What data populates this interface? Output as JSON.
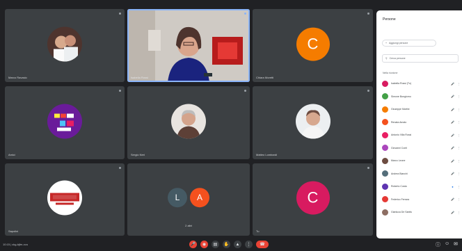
{
  "panel": {
    "title": "Persone",
    "add_label": "Aggiungi persone",
    "search_placeholder": "Cerca persone",
    "section_label": "Nella riunione",
    "participants": [
      {
        "name": "Isabella Rossi (Tu)",
        "color": "#d81b60"
      },
      {
        "name": "Simone Bongiorno",
        "color": "#43a047"
      },
      {
        "name": "Giuseppe Martini",
        "color": "#f57c00"
      },
      {
        "name": "Renata Amato",
        "color": "#f4511e"
      },
      {
        "name": "Antonio Villa Rossi",
        "color": "#e91e63"
      },
      {
        "name": "Giovanni Conti",
        "color": "#ab47bc"
      },
      {
        "name": "Marco Leone",
        "color": "#6d4c41"
      },
      {
        "name": "Andrea Bianchi",
        "color": "#546e7a"
      },
      {
        "name": "Roberto Costa",
        "color": "#5e35b1"
      },
      {
        "name": "Federico Ferrara",
        "color": "#e53935"
      },
      {
        "name": "Gianluca De Santis",
        "color": "#8d6e63"
      }
    ]
  },
  "tiles": [
    {
      "name": "Marco Ravasio",
      "type": "photo",
      "bg": "#3a2a2a"
    },
    {
      "name": "Isabella Rossi",
      "type": "video",
      "active": true
    },
    {
      "name": "Chiara Moretti",
      "type": "letter",
      "letter": "C",
      "color": "#f57c00"
    },
    {
      "name": "Amici",
      "type": "photo",
      "bg": "#6a1b9a"
    },
    {
      "name": "Sergio Neri",
      "type": "photo",
      "bg": "#d7ccc8"
    },
    {
      "name": "Matteo Lombardi",
      "type": "photo",
      "bg": "#eceff1"
    },
    {
      "name": "Sapolini",
      "type": "photo",
      "bg": "#ffffff"
    },
    {
      "name": "2 altri",
      "type": "group",
      "letters": [
        "L",
        "A"
      ],
      "colors": [
        "#455a64",
        "#f4511e"
      ]
    },
    {
      "name": "Tu",
      "type": "letter",
      "letter": "C",
      "color": "#d81b60"
    }
  ],
  "bottombar": {
    "meeting_info": "10:15 | ckg-bjfm-xvu"
  }
}
